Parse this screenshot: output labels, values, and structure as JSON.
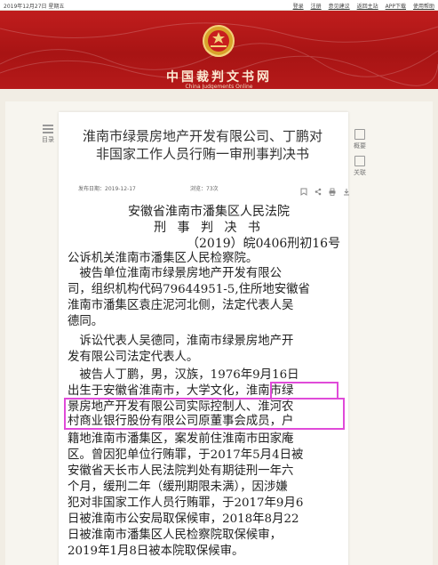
{
  "topbar": {
    "date": "2019年12月27日 星期五",
    "links": [
      "登录",
      "注册",
      "意见建议",
      "返回主站",
      "APP下载",
      "使用帮助"
    ]
  },
  "header": {
    "title": "中国裁判文书网",
    "subtitle": "China Judgements Online",
    "emblem_icon": "court-emblem-icon"
  },
  "sidebar_left": {
    "label": "目录"
  },
  "sidebar_right": {
    "items": [
      "概要",
      "关联"
    ]
  },
  "document": {
    "title_lines": [
      "淮南市绿景房地产开发有限公司、丁鹏对",
      "非国家工作人员行贿一审刑事判决书"
    ],
    "publish_label": "发布日期：2019-12-17",
    "views_label": "浏览：73次",
    "court": "安徽省淮南市潘集区人民法院",
    "doc_type": "刑 事 判 决 书",
    "case_number": "（2019）皖0406刑初16号",
    "body_lines": [
      "公诉机关淮南市潘集区人民检察院。",
      "　被告单位淮南市绿景房地产开发有限公",
      "司，组织机构代码79644951-5,住所地安徽省",
      "淮南市潘集区袁庄泥河北侧，法定代表人吴",
      "德同。",
      "　诉讼代表人吴德同，淮南市绿景房地产开",
      "发有限公司法定代表人。",
      "　被告人丁鹏，男，汉族，1976年9月16日",
      "出生于安徽省淮南市，大学文化，淮南市绿",
      "景房地产开发有限公司实际控制人、淮河农",
      "村商业银行股份有限公司原董事会成员，户",
      "籍地淮南市潘集区，案发前住淮南市田家庵",
      "区。曾因犯单位行贿罪，于2017年5月4日被",
      "安徽省天长市人民法院判处有期徒刑一年六",
      "个月，缓刑二年（缓刑期限未满），因涉嫌",
      "犯对非国家工作人员行贿罪，于2017年9月6",
      "日被淮南市公安局取保候审，2018年8月22",
      "日被淮南市潘集区人民检察院取保候审，",
      "2019年1月8日被本院取保候审。"
    ]
  },
  "colors": {
    "header_red": "#b51919",
    "highlight": "#e04bd9"
  }
}
